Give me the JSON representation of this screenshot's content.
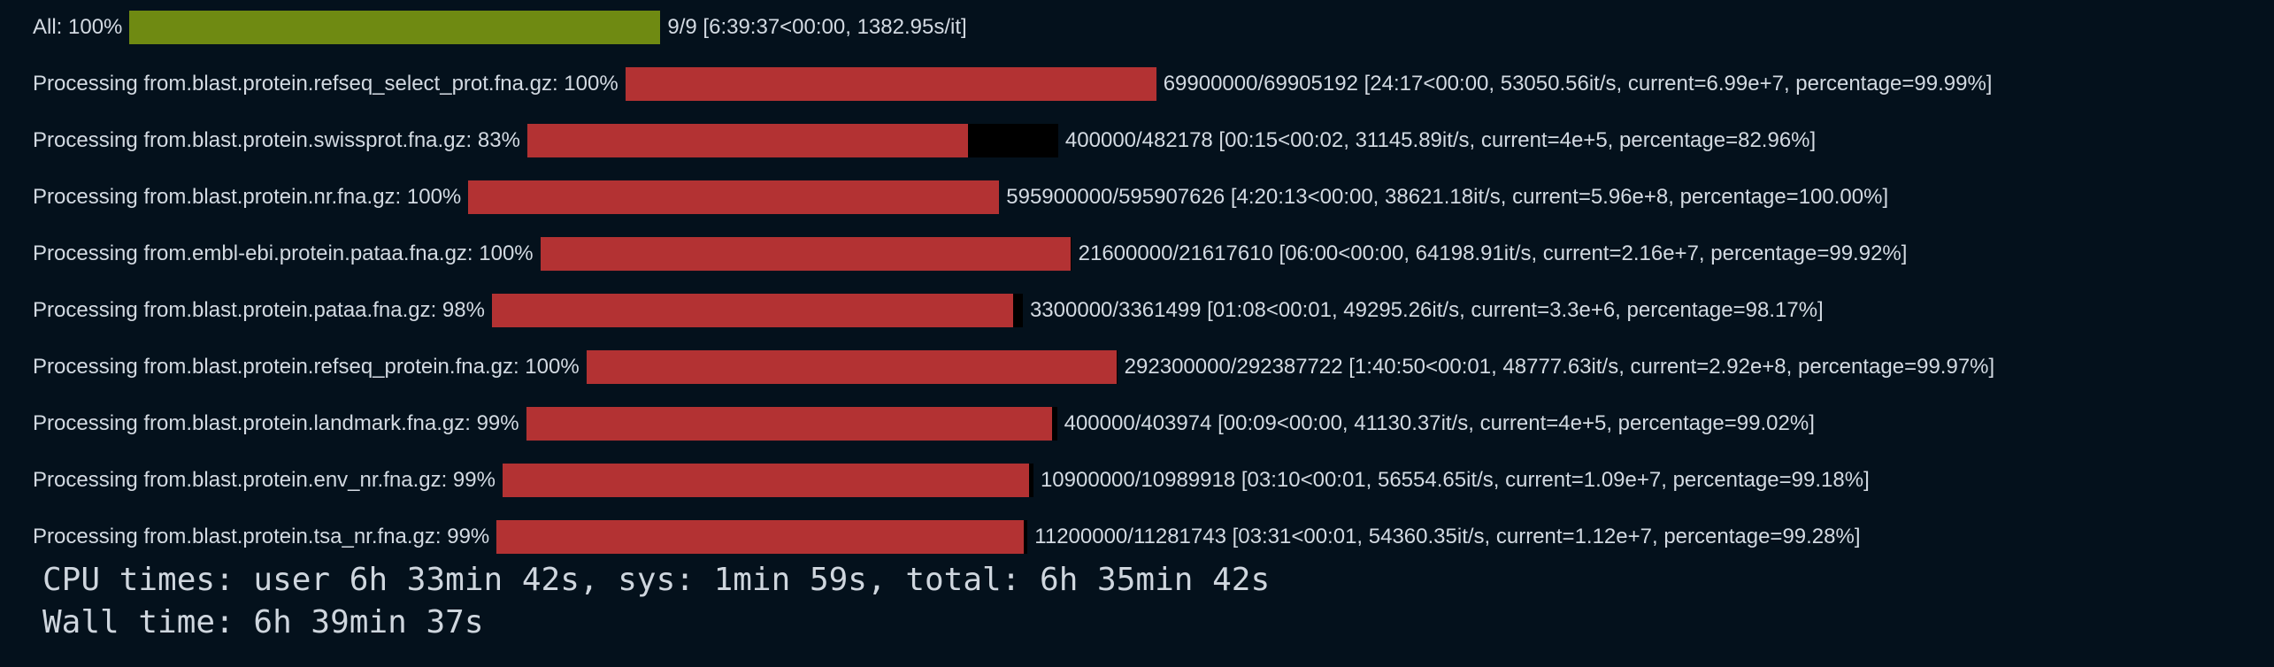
{
  "colors": {
    "background": "#04111c",
    "text": "#d3dae2",
    "overall_bar": "#6f8a12",
    "task_bar": "#b33233",
    "empty_bar": "#000000"
  },
  "overall": {
    "label": "All: 100%",
    "progress": 1.0,
    "stats": "9/9 [6:39:37<00:00, 1382.95s/it]"
  },
  "tasks": [
    {
      "label": "Processing from.blast.protein.refseq_select_prot.fna.gz: 100%",
      "progress": 0.99992,
      "stats": "69900000/69905192 [24:17<00:00, 53050.56it/s, current=6.99e+7, percentage=99.99%]"
    },
    {
      "label": "Processing from.blast.protein.swissprot.fna.gz: 83%",
      "progress": 0.8296,
      "stats": "400000/482178 [00:15<00:02, 31145.89it/s, current=4e+5, percentage=82.96%]"
    },
    {
      "label": "Processing from.blast.protein.nr.fna.gz: 100%",
      "progress": 0.99999,
      "stats": "595900000/595907626 [4:20:13<00:00, 38621.18it/s, current=5.96e+8, percentage=100.00%]"
    },
    {
      "label": "Processing from.embl-ebi.protein.pataa.fna.gz: 100%",
      "progress": 0.9992,
      "stats": "21600000/21617610 [06:00<00:00, 64198.91it/s, current=2.16e+7, percentage=99.92%]"
    },
    {
      "label": "Processing from.blast.protein.pataa.fna.gz: 98%",
      "progress": 0.9817,
      "stats": "3300000/3361499 [01:08<00:01, 49295.26it/s, current=3.3e+6, percentage=98.17%]"
    },
    {
      "label": "Processing from.blast.protein.refseq_protein.fna.gz: 100%",
      "progress": 0.9997,
      "stats": "292300000/292387722 [1:40:50<00:01, 48777.63it/s, current=2.92e+8, percentage=99.97%]"
    },
    {
      "label": "Processing from.blast.protein.landmark.fna.gz: 99%",
      "progress": 0.9902,
      "stats": "400000/403974 [00:09<00:00, 41130.37it/s, current=4e+5, percentage=99.02%]"
    },
    {
      "label": "Processing from.blast.protein.env_nr.fna.gz: 99%",
      "progress": 0.9918,
      "stats": "10900000/10989918 [03:10<00:01, 56554.65it/s, current=1.09e+7, percentage=99.18%]"
    },
    {
      "label": "Processing from.blast.protein.tsa_nr.fna.gz: 99%",
      "progress": 0.9928,
      "stats": "11200000/11281743 [03:31<00:01, 54360.35it/s, current=1.12e+7, percentage=99.28%]"
    }
  ],
  "summary": {
    "cpu_times": "CPU times: user 6h 33min 42s, sys: 1min 59s, total: 6h 35min 42s",
    "wall_time": "Wall time: 6h 39min 37s"
  }
}
